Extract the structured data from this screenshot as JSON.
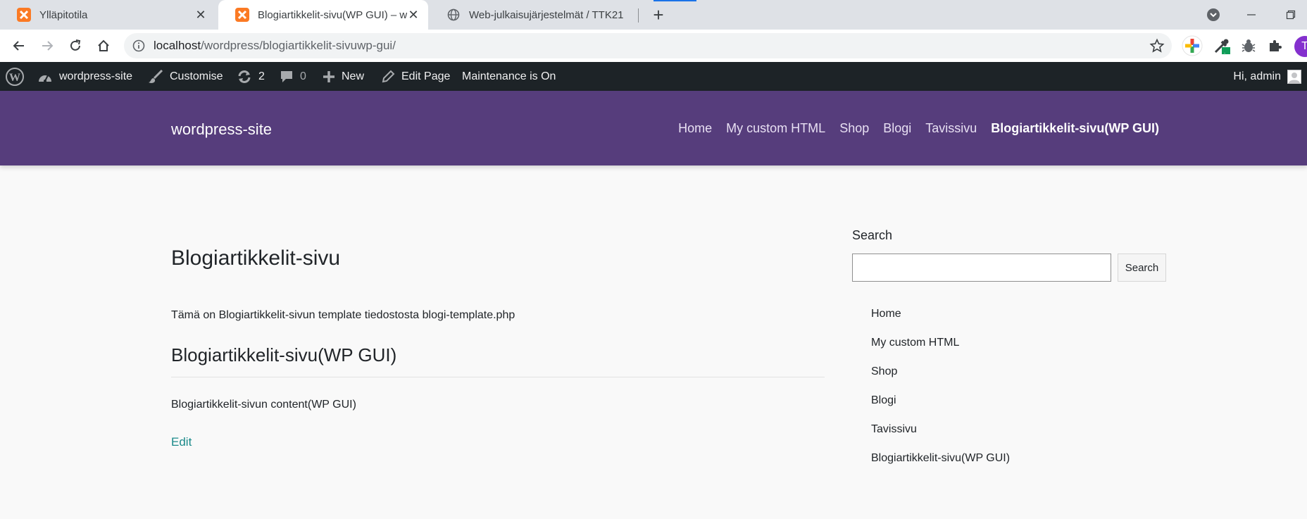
{
  "browser": {
    "tabs": [
      {
        "title": "Ylläpitotila",
        "active": false
      },
      {
        "title": "Blogiartikkelit-sivu(WP GUI) – wo",
        "active": true
      },
      {
        "title": "Web-julkaisujärjestelmät / TTK21",
        "active": false
      }
    ],
    "url_host": "localhost",
    "url_path": "/wordpress/blogiartikkelit-sivuwp-gui/",
    "profile_initial": "T",
    "colors": {
      "tabbar": "#dee1e6",
      "accent": "#1a73e8",
      "profile": "#8430ce"
    }
  },
  "adminbar": {
    "site_name": "wordpress-site",
    "customise": "Customise",
    "updates_count": "2",
    "comments_count": "0",
    "new_label": "New",
    "edit_page": "Edit Page",
    "maintenance": "Maintenance is On",
    "greeting": "Hi, admin"
  },
  "header": {
    "site_title": "wordpress-site",
    "menu": [
      "Home",
      "My custom HTML",
      "Shop",
      "Blogi",
      "Tavissivu",
      "Blogiartikkelit-sivu(WP GUI)"
    ],
    "colors": {
      "background": "#563d7c"
    }
  },
  "content": {
    "page_title": "Blogiartikkelit-sivu",
    "template_text": "Tämä on Blogiartikkelit-sivun template tiedostosta blogi-template.php",
    "heading": "Blogiartikkelit-sivu(WP GUI)",
    "body_text": "Blogiartikkelit-sivun content(WP GUI)",
    "edit_link": "Edit"
  },
  "sidebar": {
    "search_label": "Search",
    "search_button": "Search",
    "search_value": "",
    "pages": [
      "Home",
      "My custom HTML",
      "Shop",
      "Blogi",
      "Tavissivu",
      "Blogiartikkelit-sivu(WP GUI)"
    ]
  }
}
